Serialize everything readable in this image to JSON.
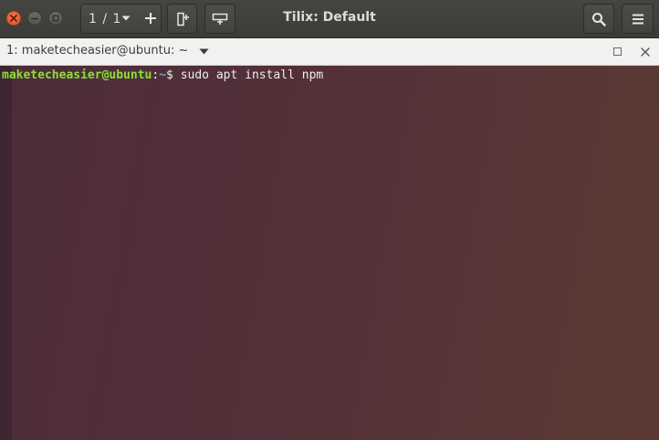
{
  "window": {
    "title": "Tilix: Default"
  },
  "headerbar": {
    "session_count": "1 / 1",
    "icons": {
      "close": "close-icon",
      "minimize": "minimize-icon",
      "maximize": "maximize-icon",
      "session_dropdown": "chevron-down-icon",
      "add_session": "plus-icon",
      "split_right": "split-right-icon",
      "split_down": "split-down-icon",
      "search": "search-icon",
      "menu": "hamburger-menu-icon"
    }
  },
  "terminal_tab": {
    "title": "1: maketecheasier@ubuntu: ~"
  },
  "terminal": {
    "prompt_user": "maketecheasier@ubuntu",
    "prompt_sep": ":",
    "prompt_path": "~",
    "prompt_symbol": "$ ",
    "command": "sudo apt install npm"
  },
  "colors": {
    "prompt_user": "#8ae234",
    "prompt_path": "#729fcf",
    "close_button": "#e95420",
    "terminal_bg": "#553238"
  }
}
